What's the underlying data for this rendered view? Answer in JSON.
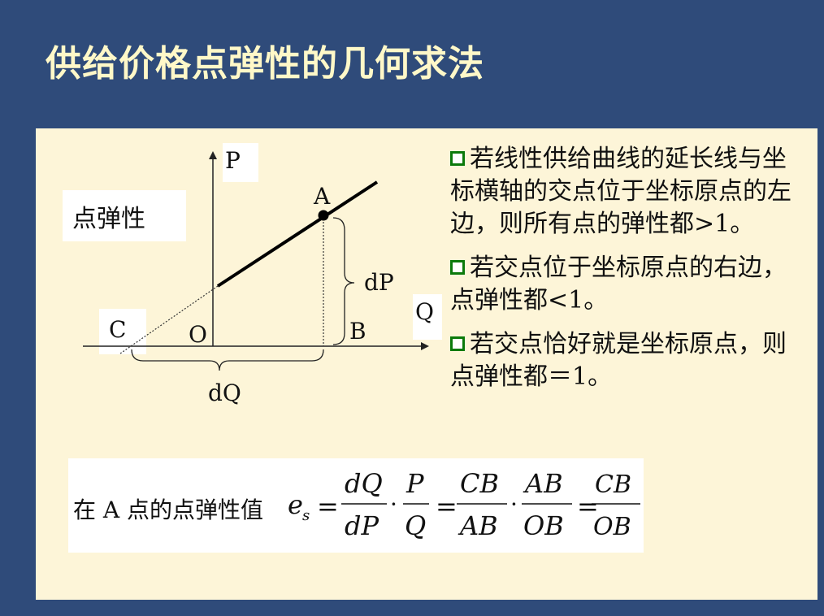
{
  "title": "供给价格点弹性的几何求法",
  "diagram": {
    "label_box": "点弹性",
    "axis_p": "P",
    "axis_q": "Q",
    "point_a": "A",
    "point_b": "B",
    "point_c": "C",
    "origin": "O",
    "dp": "dP",
    "dq": "dQ"
  },
  "rules": [
    {
      "text": "若线性供给曲线的延长线与坐标横轴的交点位于坐标原点的左边，则所有点的弹性都>1。"
    },
    {
      "text": "若交点位于坐标原点的右边，点弹性都<1。"
    },
    {
      "text": "若交点恰好就是坐标原点，则点弹性都＝1。"
    }
  ],
  "formula": {
    "prefix": "在 A 点的点弹性值",
    "lhs": "e",
    "lhs_sub": "s",
    "eq": "=",
    "frac1_num": "dQ",
    "frac1_den": "dP",
    "frac2_num": "P",
    "frac2_den": "Q",
    "frac3_num": "CB",
    "frac3_den": "AB",
    "frac4_num": "AB",
    "frac4_den": "OB",
    "frac5_num": "CB",
    "frac5_den": "OB",
    "dot": "·"
  },
  "colors": {
    "background": "#2f4b7a",
    "title": "#fff8c8",
    "panel": "#fdf5d8",
    "bullet": "#0b7a0b"
  }
}
